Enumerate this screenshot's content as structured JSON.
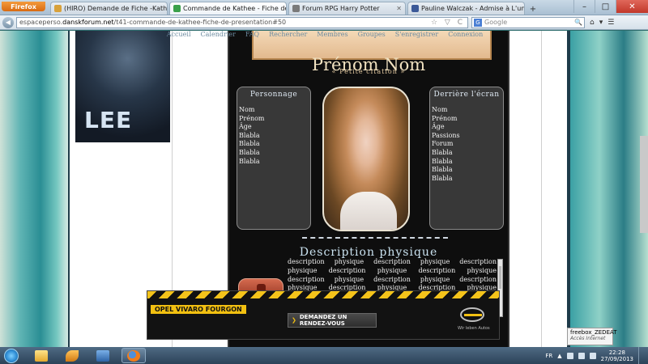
{
  "browser": {
    "app_button": "Firefox",
    "tabs": [
      {
        "label": "(HIRO) Demande de Fiche -Kathee-",
        "icon_color": "#d8a13a",
        "active": false
      },
      {
        "label": "Commande de Kathee - Fiche de pré...",
        "icon_color": "#3aa04a",
        "active": true
      },
      {
        "label": "Forum RPG Harry Potter",
        "icon_color": "#7a7a7a",
        "active": false
      },
      {
        "label": "Pauline Walczak - Admise à L'una :)",
        "icon_color": "#3b5998",
        "active": false
      }
    ],
    "new_tab": "+",
    "window_controls": {
      "minimize": "–",
      "maximize": "□",
      "close": "✕"
    },
    "url_prefix": "espaceperso.",
    "url_host": "danskforum.net",
    "url_path": "/t41-commande-de-kathee-fiche-de-presentation#50",
    "url_controls": "☆ ▽ C",
    "search_engine_icon": "G",
    "search_placeholder": "Google",
    "search_go": "🔍",
    "nav_right": [
      "⌂",
      "▾",
      "☰"
    ]
  },
  "forum_nav": [
    "Accueil",
    "Calendrier",
    "FAQ",
    "Rechercher",
    "Membres",
    "Groupes",
    "S'enregistrer",
    "Connexion"
  ],
  "avatar_text": "LEE",
  "card": {
    "title": "Prénom Nom",
    "subtitle": "« Petite citation »",
    "left_panel": {
      "heading": "Personnage",
      "items": [
        "Nom",
        "Prénom",
        "Âge",
        "Blabla",
        "Blabla",
        "Blabla",
        "Blabla"
      ]
    },
    "right_panel": {
      "heading": "Derrière l'écran",
      "items": [
        "Nom",
        "Prénom",
        "Âge",
        "Passions",
        "Forum",
        "Blabla",
        "Blabla",
        "Blabla",
        "Blabla"
      ]
    },
    "description_heading": "Description physique",
    "description_body": "description physique description physique description physique description physique description physique description physique description physique description physique description physique description physique description physique description physique description physique description physique description physique description physique description physique description physique description physique"
  },
  "ad": {
    "label": "OPEL VIVARO FOURGON",
    "cta": "DEMANDEZ UN RENDEZ-VOUS",
    "tagline": "Wir leben Autos"
  },
  "status_popup": {
    "line1": "freebox_ZEDEAT",
    "line2": "Accès Internet"
  },
  "taskbar": {
    "language": "FR",
    "time": "22:28",
    "date": "27/09/2013"
  }
}
